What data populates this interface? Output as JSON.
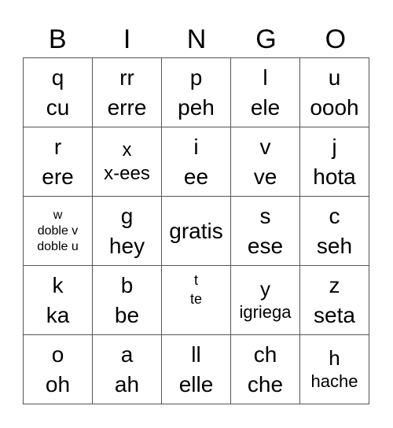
{
  "header": [
    "B",
    "I",
    "N",
    "G",
    "O"
  ],
  "cells": [
    [
      {
        "lines": [
          "q",
          "cu"
        ],
        "size": "l"
      },
      {
        "lines": [
          "rr",
          "erre"
        ],
        "size": "l"
      },
      {
        "lines": [
          "p",
          "peh"
        ],
        "size": "l"
      },
      {
        "lines": [
          "l",
          "ele"
        ],
        "size": "l"
      },
      {
        "lines": [
          "u",
          "oooh"
        ],
        "size": "l"
      }
    ],
    [
      {
        "lines": [
          "r",
          "ere"
        ],
        "size": "l"
      },
      {
        "lines": [
          "x",
          "x-ees"
        ],
        "size": "m"
      },
      {
        "lines": [
          "i",
          "ee"
        ],
        "size": "l"
      },
      {
        "lines": [
          "v",
          "ve"
        ],
        "size": "l"
      },
      {
        "lines": [
          "j",
          "hota"
        ],
        "size": "l"
      }
    ],
    [
      {
        "lines": [
          "w",
          "doble v",
          "doble u"
        ],
        "size": "xs"
      },
      {
        "lines": [
          "g",
          "hey"
        ],
        "size": "l"
      },
      {
        "lines": [
          "gratis"
        ],
        "size": "l"
      },
      {
        "lines": [
          "s",
          "ese"
        ],
        "size": "l"
      },
      {
        "lines": [
          "c",
          "seh"
        ],
        "size": "l"
      }
    ],
    [
      {
        "lines": [
          "k",
          "ka"
        ],
        "size": "l"
      },
      {
        "lines": [
          "b",
          "be"
        ],
        "size": "l"
      },
      {
        "lines": [
          "t",
          "te"
        ],
        "size": "s",
        "align": "top"
      },
      {
        "lines": [
          "y",
          "igriega"
        ],
        "size": "m2"
      },
      {
        "lines": [
          "z",
          "seta"
        ],
        "size": "l"
      }
    ],
    [
      {
        "lines": [
          "o",
          "oh"
        ],
        "size": "l"
      },
      {
        "lines": [
          "a",
          "ah"
        ],
        "size": "l"
      },
      {
        "lines": [
          "ll",
          "elle"
        ],
        "size": "l"
      },
      {
        "lines": [
          "ch",
          "che"
        ],
        "size": "l"
      },
      {
        "lines": [
          "h",
          "hache"
        ],
        "size": "m2"
      }
    ]
  ]
}
